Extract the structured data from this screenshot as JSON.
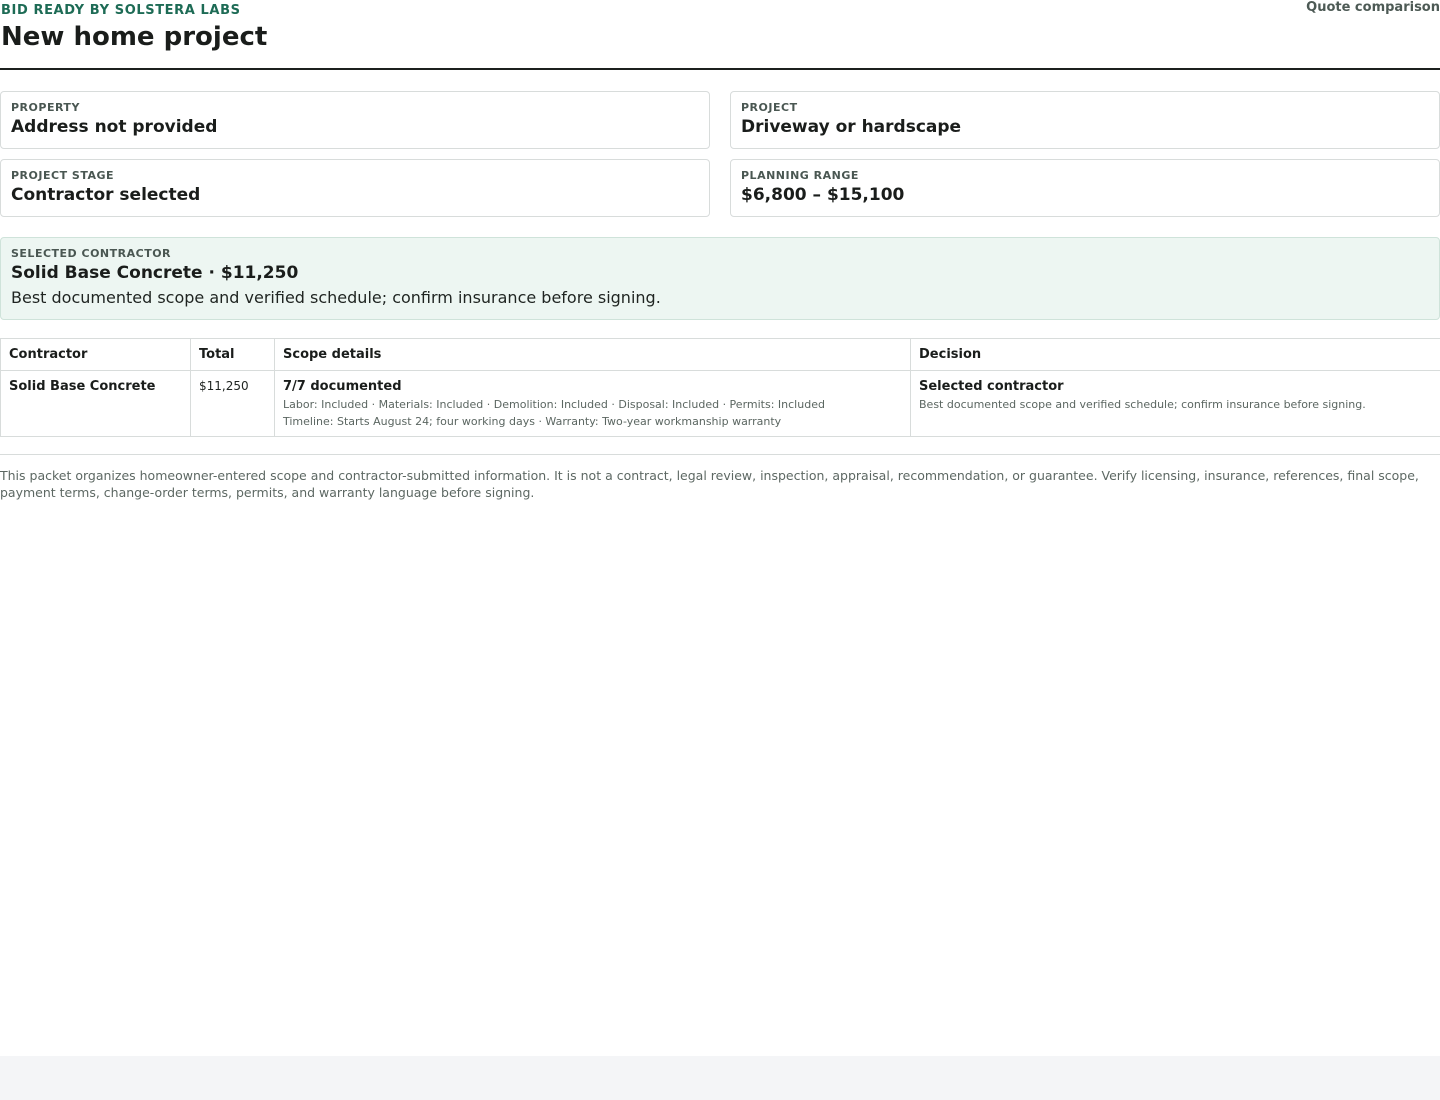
{
  "header": {
    "brand": "BID READY BY SOLSTERA LABS",
    "title": "New home project",
    "doc_type": "Quote comparison"
  },
  "cards": {
    "property": {
      "label": "PROPERTY",
      "value": "Address not provided"
    },
    "project": {
      "label": "PROJECT",
      "value": "Driveway or hardscape"
    },
    "stage": {
      "label": "PROJECT STAGE",
      "value": "Contractor selected"
    },
    "range": {
      "label": "PLANNING RANGE",
      "value": "$6,800 – $15,100"
    }
  },
  "selected": {
    "label": "SELECTED CONTRACTOR",
    "title": "Solid Base Concrete · $11,250",
    "note": "Best documented scope and verified schedule; confirm insurance before signing."
  },
  "table": {
    "headers": [
      "Contractor",
      "Total",
      "Scope details",
      "Decision"
    ],
    "rows": [
      {
        "contractor": "Solid Base Concrete",
        "total": "$11,250",
        "scope_summary": "7/7 documented",
        "scope_items": "Labor: Included · Materials: Included · Demolition: Included · Disposal: Included · Permits: Included",
        "scope_timeline": "Timeline: Starts August 24; four working days · Warranty: Two-year workmanship warranty",
        "decision": "Selected contractor",
        "decision_note": "Best documented scope and verified schedule; confirm insurance before signing."
      }
    ]
  },
  "disclaimer": "This packet organizes homeowner-entered scope and contractor-submitted information. It is not a contract, legal review, inspection, appraisal, recommendation, or guarantee. Verify licensing, insurance, references, final scope, payment terms, change-order terms, permits, and warranty language before signing.",
  "colors": {
    "brand": "#1d6b55",
    "selected_background": "#edf6f2",
    "border": "#d8dcdb",
    "text": "#1a1d1b"
  }
}
